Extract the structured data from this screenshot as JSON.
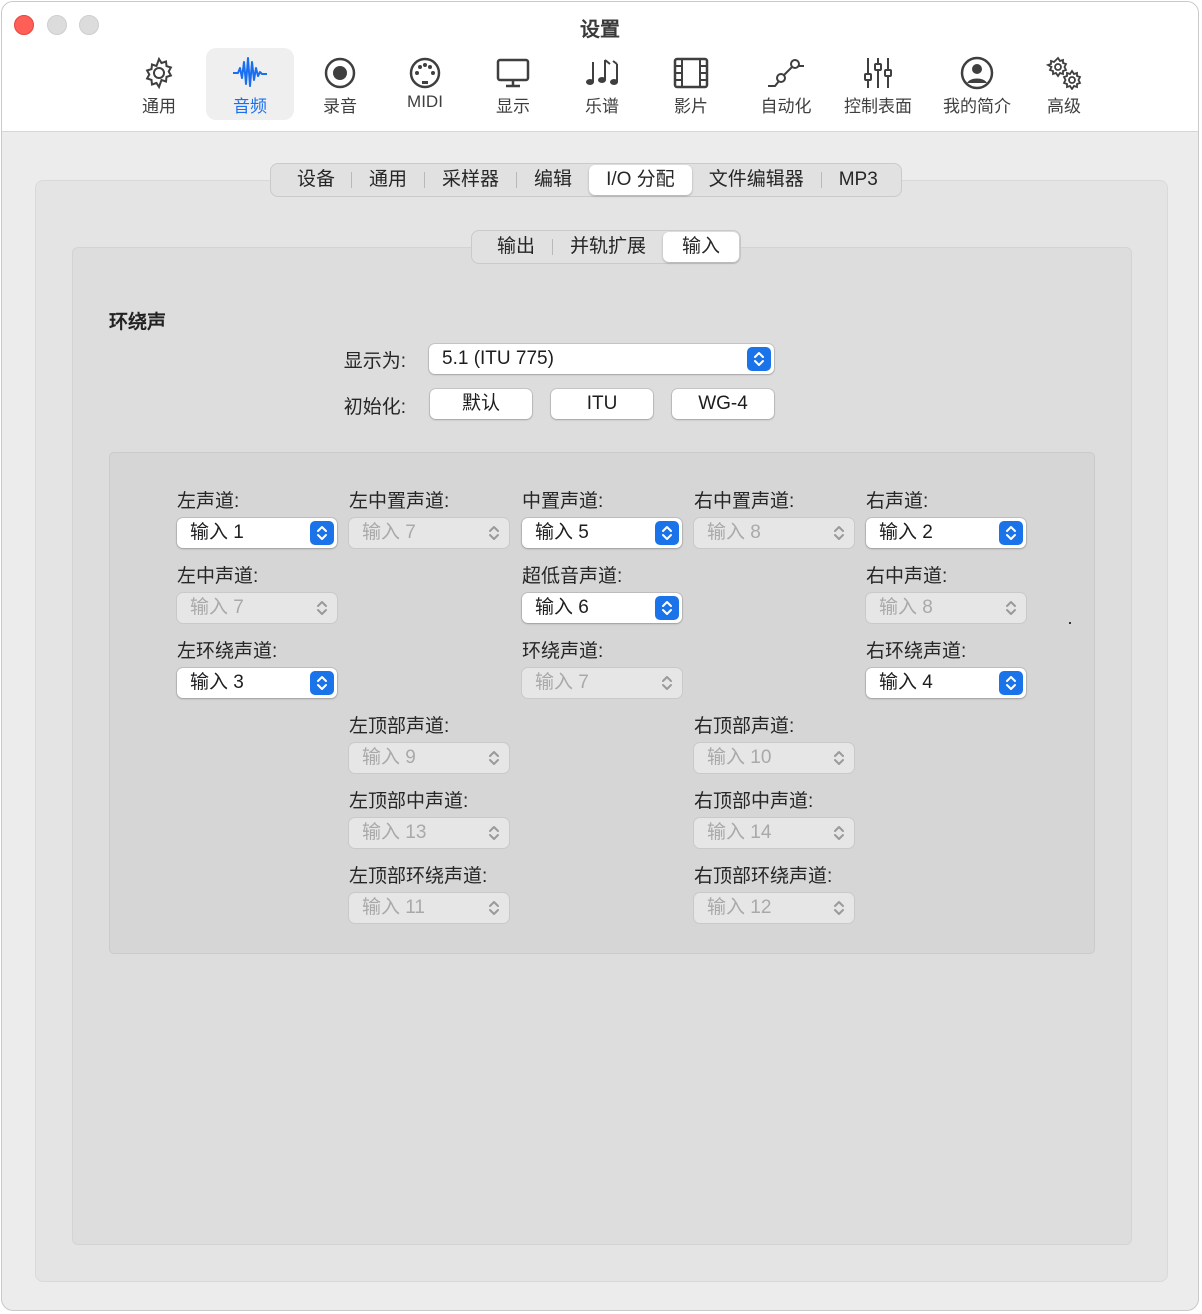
{
  "window": {
    "title": "设置"
  },
  "toolbar": {
    "items": [
      {
        "label": "通用",
        "icon": "gear-icon"
      },
      {
        "label": "音频",
        "icon": "waveform-icon",
        "active": true
      },
      {
        "label": "录音",
        "icon": "record-icon"
      },
      {
        "label": "MIDI",
        "icon": "midi-port-icon"
      },
      {
        "label": "显示",
        "icon": "display-icon"
      },
      {
        "label": "乐谱",
        "icon": "music-notes-icon"
      },
      {
        "label": "影片",
        "icon": "film-icon"
      },
      {
        "label": "自动化",
        "icon": "automation-icon"
      },
      {
        "label": "控制表面",
        "icon": "sliders-icon"
      },
      {
        "label": "我的简介",
        "icon": "profile-icon"
      },
      {
        "label": "高级",
        "icon": "gears-icon"
      }
    ]
  },
  "tabs": [
    "设备",
    "通用",
    "采样器",
    "编辑",
    "I/O 分配",
    "文件编辑器",
    "MP3"
  ],
  "selected_tab": "I/O 分配",
  "subtabs": [
    "输出",
    "并轨扩展",
    "输入"
  ],
  "selected_subtab": "输入",
  "surround": {
    "section_title": "环绕声",
    "show_as_label": "显示为:",
    "show_as_value": "5.1 (ITU 775)",
    "init_label": "初始化:",
    "init_buttons": [
      "默认",
      "ITU",
      "WG-4"
    ]
  },
  "channels": {
    "left": {
      "label": "左声道:",
      "value": "输入 1",
      "enabled": true
    },
    "left_center": {
      "label": "左中置声道:",
      "value": "输入 7",
      "enabled": false
    },
    "center": {
      "label": "中置声道:",
      "value": "输入 5",
      "enabled": true
    },
    "right_center": {
      "label": "右中置声道:",
      "value": "输入 8",
      "enabled": false
    },
    "right": {
      "label": "右声道:",
      "value": "输入 2",
      "enabled": true
    },
    "left_mid": {
      "label": "左中声道:",
      "value": "输入 7",
      "enabled": false
    },
    "lfe": {
      "label": "超低音声道:",
      "value": "输入 6",
      "enabled": true
    },
    "right_mid": {
      "label": "右中声道:",
      "value": "输入 8",
      "enabled": false
    },
    "left_surround": {
      "label": "左环绕声道:",
      "value": "输入 3",
      "enabled": true
    },
    "surround": {
      "label": "环绕声道:",
      "value": "输入 7",
      "enabled": false
    },
    "right_surround": {
      "label": "右环绕声道:",
      "value": "输入 4",
      "enabled": true
    },
    "left_top": {
      "label": "左顶部声道:",
      "value": "输入 9",
      "enabled": false
    },
    "right_top": {
      "label": "右顶部声道:",
      "value": "输入 10",
      "enabled": false
    },
    "left_top_center": {
      "label": "左顶部中声道:",
      "value": "输入 13",
      "enabled": false
    },
    "right_top_center": {
      "label": "右顶部中声道:",
      "value": "输入 14",
      "enabled": false
    },
    "left_top_surround": {
      "label": "左顶部环绕声道:",
      "value": "输入 11",
      "enabled": false
    },
    "right_top_surround": {
      "label": "右顶部环绕声道:",
      "value": "输入 12",
      "enabled": false
    }
  },
  "colors": {
    "accent": "#1a73e8",
    "close": "#ff5f57"
  }
}
